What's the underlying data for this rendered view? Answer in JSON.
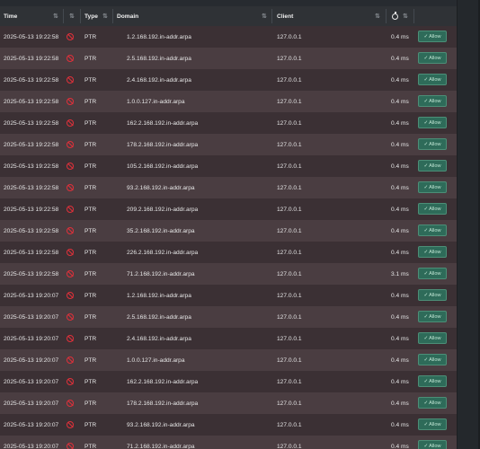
{
  "header": {
    "time": "Time",
    "type": "Type",
    "domain": "Domain",
    "client": "Client",
    "duration_icon": "stopwatch-icon",
    "sort_icon": "sort-arrows-icon"
  },
  "status_icon": "blocked-circle-icon",
  "allow_label": "Allow",
  "check_icon": "checkmark-icon",
  "colors": {
    "row_odd": "#4a3d41",
    "row_even": "#3b3034",
    "blocked_red": "#e0303a",
    "allow_green": "#2e6b59"
  },
  "rows": [
    {
      "time": "2025-05-13 19:22:58",
      "type": "PTR",
      "domain": "1.2.168.192.in-addr.arpa",
      "client": "127.0.0.1",
      "duration": "0.4 ms"
    },
    {
      "time": "2025-05-13 19:22:58",
      "type": "PTR",
      "domain": "2.5.168.192.in-addr.arpa",
      "client": "127.0.0.1",
      "duration": "0.4 ms"
    },
    {
      "time": "2025-05-13 19:22:58",
      "type": "PTR",
      "domain": "2.4.168.192.in-addr.arpa",
      "client": "127.0.0.1",
      "duration": "0.4 ms"
    },
    {
      "time": "2025-05-13 19:22:58",
      "type": "PTR",
      "domain": "1.0.0.127.in-addr.arpa",
      "client": "127.0.0.1",
      "duration": "0.4 ms"
    },
    {
      "time": "2025-05-13 19:22:58",
      "type": "PTR",
      "domain": "162.2.168.192.in-addr.arpa",
      "client": "127.0.0.1",
      "duration": "0.4 ms"
    },
    {
      "time": "2025-05-13 19:22:58",
      "type": "PTR",
      "domain": "178.2.168.192.in-addr.arpa",
      "client": "127.0.0.1",
      "duration": "0.4 ms"
    },
    {
      "time": "2025-05-13 19:22:58",
      "type": "PTR",
      "domain": "105.2.168.192.in-addr.arpa",
      "client": "127.0.0.1",
      "duration": "0.4 ms"
    },
    {
      "time": "2025-05-13 19:22:58",
      "type": "PTR",
      "domain": "93.2.168.192.in-addr.arpa",
      "client": "127.0.0.1",
      "duration": "0.4 ms"
    },
    {
      "time": "2025-05-13 19:22:58",
      "type": "PTR",
      "domain": "209.2.168.192.in-addr.arpa",
      "client": "127.0.0.1",
      "duration": "0.4 ms"
    },
    {
      "time": "2025-05-13 19:22:58",
      "type": "PTR",
      "domain": "35.2.168.192.in-addr.arpa",
      "client": "127.0.0.1",
      "duration": "0.4 ms"
    },
    {
      "time": "2025-05-13 19:22:58",
      "type": "PTR",
      "domain": "226.2.168.192.in-addr.arpa",
      "client": "127.0.0.1",
      "duration": "0.4 ms"
    },
    {
      "time": "2025-05-13 19:22:58",
      "type": "PTR",
      "domain": "71.2.168.192.in-addr.arpa",
      "client": "127.0.0.1",
      "duration": "3.1 ms"
    },
    {
      "time": "2025-05-13 19:20:07",
      "type": "PTR",
      "domain": "1.2.168.192.in-addr.arpa",
      "client": "127.0.0.1",
      "duration": "0.4 ms"
    },
    {
      "time": "2025-05-13 19:20:07",
      "type": "PTR",
      "domain": "2.5.168.192.in-addr.arpa",
      "client": "127.0.0.1",
      "duration": "0.4 ms"
    },
    {
      "time": "2025-05-13 19:20:07",
      "type": "PTR",
      "domain": "2.4.168.192.in-addr.arpa",
      "client": "127.0.0.1",
      "duration": "0.4 ms"
    },
    {
      "time": "2025-05-13 19:20:07",
      "type": "PTR",
      "domain": "1.0.0.127.in-addr.arpa",
      "client": "127.0.0.1",
      "duration": "0.4 ms"
    },
    {
      "time": "2025-05-13 19:20:07",
      "type": "PTR",
      "domain": "162.2.168.192.in-addr.arpa",
      "client": "127.0.0.1",
      "duration": "0.4 ms"
    },
    {
      "time": "2025-05-13 19:20:07",
      "type": "PTR",
      "domain": "178.2.168.192.in-addr.arpa",
      "client": "127.0.0.1",
      "duration": "0.4 ms"
    },
    {
      "time": "2025-05-13 19:20:07",
      "type": "PTR",
      "domain": "93.2.168.192.in-addr.arpa",
      "client": "127.0.0.1",
      "duration": "0.4 ms"
    },
    {
      "time": "2025-05-13 19:20:07",
      "type": "PTR",
      "domain": "71.2.168.192.in-addr.arpa",
      "client": "127.0.0.1",
      "duration": "0.4 ms"
    }
  ]
}
